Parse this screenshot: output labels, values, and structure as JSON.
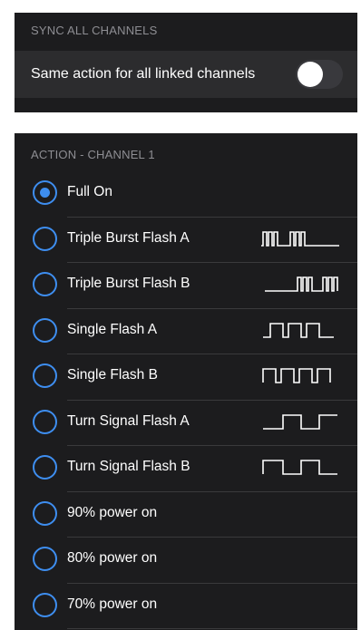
{
  "sync": {
    "header": "SYNC ALL CHANNELS",
    "label": "Same action for all linked channels",
    "toggle_on": false
  },
  "action": {
    "header": "ACTION - CHANNEL 1",
    "options": [
      {
        "label": "Full On",
        "selected": true,
        "wave": ""
      },
      {
        "label": "Triple Burst Flash A",
        "selected": false,
        "wave": "triple-burst-a"
      },
      {
        "label": "Triple Burst Flash B",
        "selected": false,
        "wave": "triple-burst-b"
      },
      {
        "label": "Single Flash A",
        "selected": false,
        "wave": "single-flash-a"
      },
      {
        "label": "Single Flash B",
        "selected": false,
        "wave": "single-flash-b"
      },
      {
        "label": "Turn Signal Flash A",
        "selected": false,
        "wave": "turn-signal-a"
      },
      {
        "label": "Turn Signal Flash B",
        "selected": false,
        "wave": "turn-signal-b"
      },
      {
        "label": "90% power on",
        "selected": false,
        "wave": ""
      },
      {
        "label": "80% power on",
        "selected": false,
        "wave": ""
      },
      {
        "label": "70% power on",
        "selected": false,
        "wave": ""
      }
    ]
  },
  "colors": {
    "accent": "#3e8ef0",
    "panel": "#1c1c1e",
    "row": "#2c2c2e",
    "header_text": "#8e8e93"
  }
}
